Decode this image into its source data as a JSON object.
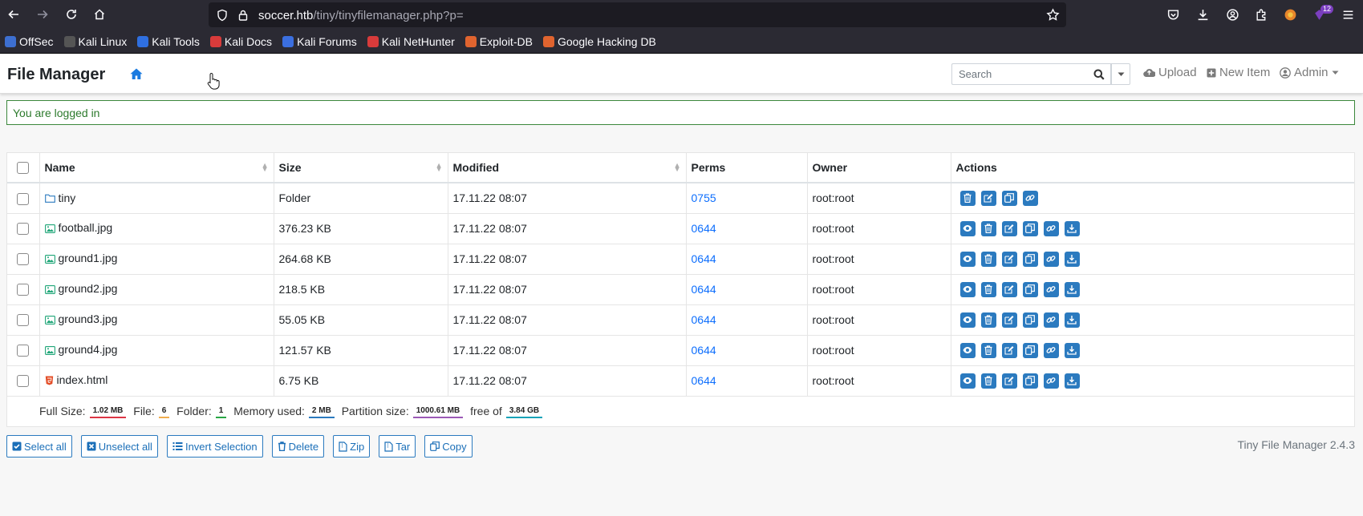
{
  "browser": {
    "url_host": "soccer.htb",
    "url_path": "/tiny/tinyfilemanager.php?p=",
    "extension_badge": "12",
    "bookmarks": [
      {
        "label": "OffSec",
        "color": "#3d6fd1"
      },
      {
        "label": "Kali Linux",
        "color": "#555555"
      },
      {
        "label": "Kali Tools",
        "color": "#2f6fe0"
      },
      {
        "label": "Kali Docs",
        "color": "#d83b3b"
      },
      {
        "label": "Kali Forums",
        "color": "#3b6fe0"
      },
      {
        "label": "Kali NetHunter",
        "color": "#d83b3b"
      },
      {
        "label": "Exploit-DB",
        "color": "#e0642f"
      },
      {
        "label": "Google Hacking DB",
        "color": "#e0642f"
      }
    ]
  },
  "app": {
    "brand": "File Manager",
    "search_placeholder": "Search",
    "upload_label": "Upload",
    "new_item_label": "New Item",
    "admin_label": "Admin",
    "alert": "You are logged in",
    "version": "Tiny File Manager 2.4.3"
  },
  "table": {
    "headers": {
      "name": "Name",
      "size": "Size",
      "modified": "Modified",
      "perms": "Perms",
      "owner": "Owner",
      "actions": "Actions"
    },
    "rows": [
      {
        "name": "tiny",
        "type": "folder",
        "size": "Folder",
        "modified": "17.11.22 08:07",
        "perms": "0755",
        "owner": "root:root"
      },
      {
        "name": "football.jpg",
        "type": "image",
        "size": "376.23 KB",
        "modified": "17.11.22 08:07",
        "perms": "0644",
        "owner": "root:root"
      },
      {
        "name": "ground1.jpg",
        "type": "image",
        "size": "264.68 KB",
        "modified": "17.11.22 08:07",
        "perms": "0644",
        "owner": "root:root"
      },
      {
        "name": "ground2.jpg",
        "type": "image",
        "size": "218.5 KB",
        "modified": "17.11.22 08:07",
        "perms": "0644",
        "owner": "root:root"
      },
      {
        "name": "ground3.jpg",
        "type": "image",
        "size": "55.05 KB",
        "modified": "17.11.22 08:07",
        "perms": "0644",
        "owner": "root:root"
      },
      {
        "name": "ground4.jpg",
        "type": "image",
        "size": "121.57 KB",
        "modified": "17.11.22 08:07",
        "perms": "0644",
        "owner": "root:root"
      },
      {
        "name": "index.html",
        "type": "html",
        "size": "6.75 KB",
        "modified": "17.11.22 08:07",
        "perms": "0644",
        "owner": "root:root"
      }
    ],
    "footer": {
      "full_size_label": "Full Size:",
      "full_size": "1.02 MB",
      "file_label": "File:",
      "file_count": "6",
      "folder_label": "Folder:",
      "folder_count": "1",
      "memory_label": "Memory used:",
      "memory": "2 MB",
      "partition_label": "Partition size:",
      "partition": "1000.61 MB",
      "free_label": "free of",
      "free": "3.84 GB"
    }
  },
  "bottom_buttons": {
    "select_all": "Select all",
    "unselect_all": "Unselect all",
    "invert": "Invert Selection",
    "delete": "Delete",
    "zip": "Zip",
    "tar": "Tar",
    "copy": "Copy"
  },
  "colors": {
    "accent": "#2b7abf",
    "link": "#0d6efd",
    "alert_green": "#3b873b"
  }
}
